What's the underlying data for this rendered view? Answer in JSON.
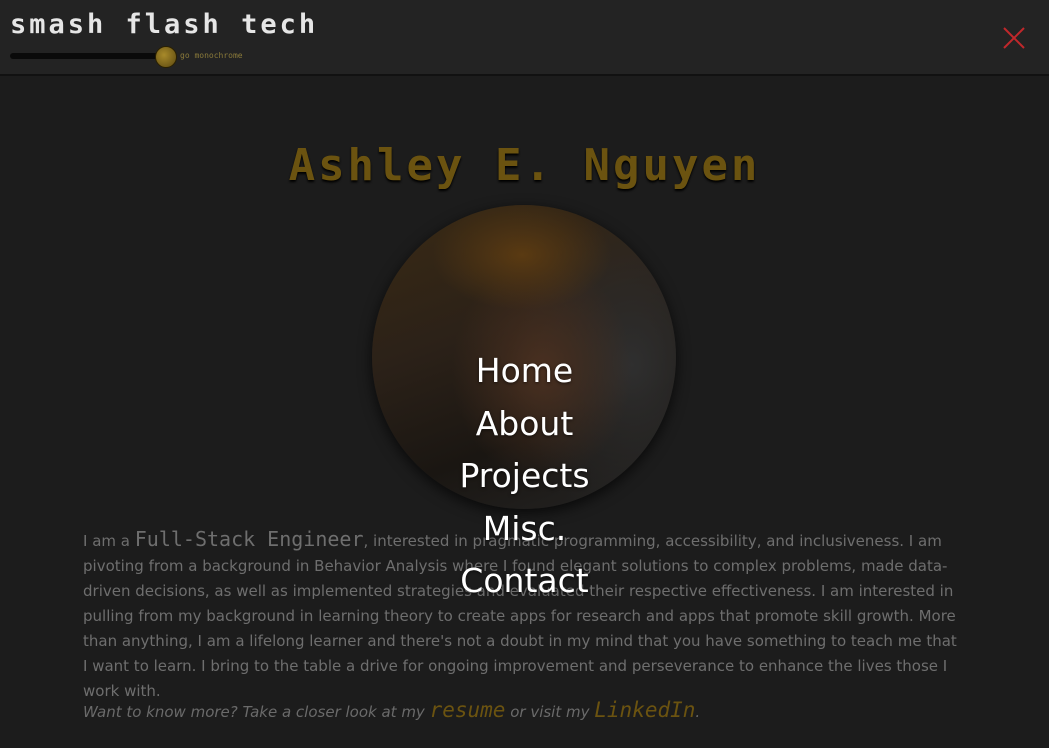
{
  "header": {
    "brand": "smash flash tech",
    "slider_label": "go monochrome",
    "slider_value_percent": 92
  },
  "profile": {
    "name": "Ashley E. Nguyen"
  },
  "bio": {
    "prefix": "I am a ",
    "highlight": "Full-Stack Engineer",
    "text": ", interested in pragmatic programming, accessibility, and inclusiveness. I am pivoting from a background in Behavior Analysis where I found elegant solutions to complex problems, made data-driven decisions, as well as implemented strategies and evaluated their respective effectiveness. I am interested in pulling from my background in learning theory to create apps for research and apps that promote skill growth. More than anything, I am a lifelong learner and there's not a doubt in my mind that you have something to teach me that I want to learn. I bring to the table a drive for ongoing improvement and perseverance to enhance the lives those I work with."
  },
  "cta": {
    "prefix": "Want to know more? Take a closer look at my ",
    "resume": "resume",
    "middle": " or visit my ",
    "linkedin": "LinkedIn",
    "suffix": "."
  },
  "menu": {
    "items": [
      "Home",
      "About",
      "Projects",
      "Misc.",
      "Contact"
    ]
  },
  "colors": {
    "accent_gold": "#6b5310",
    "close_red": "#c0282b"
  }
}
